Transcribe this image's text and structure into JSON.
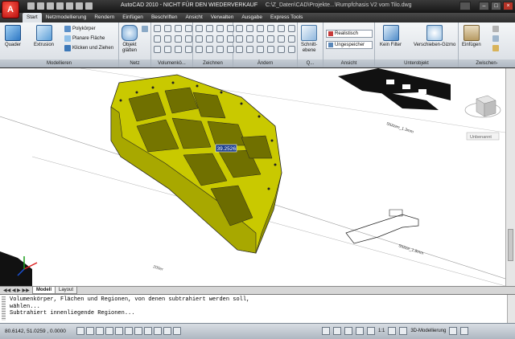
{
  "window": {
    "title_main": "AutoCAD 2010 - NICHT FÜR DEN WIEDERVERKAUF",
    "title_file": "C:\\Z_Daten\\CAD\\Projekte...\\Rumpfchasis V2 vom Tilo.dwg",
    "app_letter": "A"
  },
  "ribbon_tabs": [
    {
      "label": "Start"
    },
    {
      "label": "Netzmodellierung"
    },
    {
      "label": "Rendern"
    },
    {
      "label": "Einfügen"
    },
    {
      "label": "Beschriften"
    },
    {
      "label": "Ansicht"
    },
    {
      "label": "Verwalten"
    },
    {
      "label": "Ausgabe"
    },
    {
      "label": "Express Tools"
    }
  ],
  "ribbon": {
    "modellieren": {
      "title": "Modellieren",
      "quader": "Quader",
      "extrusion": "Extrusion",
      "polykoerper": "Polykörper",
      "planare_flaeche": "Planare Fläche",
      "klicken_ziehen": "Klicken und Ziehen"
    },
    "netz": {
      "title": "Netz",
      "objekt_glaetten_1": "Objekt",
      "objekt_glaetten_2": "glätten"
    },
    "volumen": {
      "title": "Volumenkö..."
    },
    "zeichnen": {
      "title": "Zeichnen"
    },
    "aendern": {
      "title": "Ändern"
    },
    "schnitt": {
      "title": "Q...",
      "label_1": "Schnitt-",
      "label_2": "ebene"
    },
    "ansicht": {
      "title": "Ansicht",
      "visual_style": "Realistisch",
      "saved_view": "Ungespeicher"
    },
    "unterobjekt": {
      "title": "Unterobjekt",
      "kein_filter": "Kein Filter",
      "verschieben_gizmo": "Verschieben-Gizmo"
    },
    "zwischen": {
      "title": "Zwischen-",
      "einfuegen": "Einfügen"
    }
  },
  "viewport": {
    "dimension_tooltip": "39.2526",
    "label_a": "Stützen_1.3mm",
    "label_b": "Stütze_1.8mm",
    "label_c": "200er",
    "viewcube_label": "Unbenannt"
  },
  "layout_tabs": [
    {
      "label": "Modell"
    },
    {
      "label": "Layout"
    }
  ],
  "command_lines": [
    "Volumenkörper, Flächen und Regionen, von denen subtrahiert werden soll,",
    "wählen...",
    "Subtrahiert innenliegende Regionen..."
  ],
  "status": {
    "coords": "80.6142,  51.0259 , 0.0000",
    "scale": "1:1",
    "workspace": "3D-Modellierung"
  },
  "colors": {
    "part_fill": "#c9c900",
    "part_dark": "#a8a800",
    "app_red": "#b60c0c"
  }
}
